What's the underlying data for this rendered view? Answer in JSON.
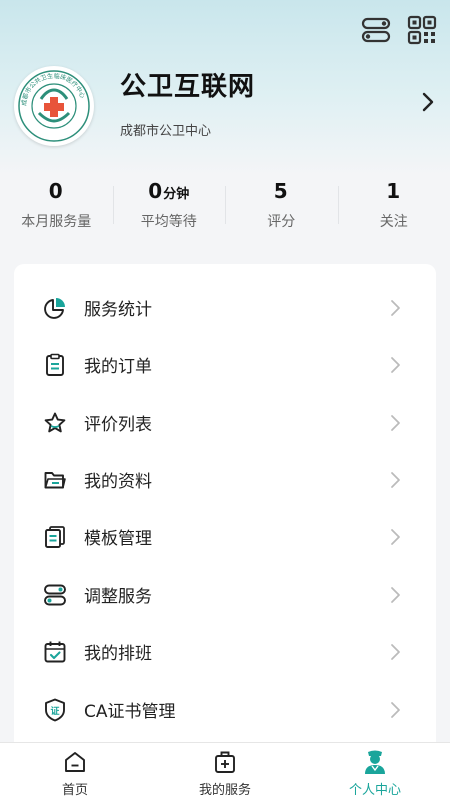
{
  "header": {
    "toggle_icon": "toggle-icon",
    "qr_icon": "qr-code-icon"
  },
  "profile": {
    "name": "公卫互联网",
    "subtitle": "成都市公卫中心",
    "logo_ring_text": "成都市公共卫生临床医疗中心",
    "arrow_icon": "chevron-right-icon"
  },
  "stats": [
    {
      "value": "0",
      "unit": "",
      "label": "本月服务量"
    },
    {
      "value": "0",
      "unit": "分钟",
      "label": "平均等待"
    },
    {
      "value": "5",
      "unit": "",
      "label": "评分"
    },
    {
      "value": "1",
      "unit": "",
      "label": "关注"
    }
  ],
  "menu": [
    {
      "label": "服务统计",
      "icon": "pie-chart-icon"
    },
    {
      "label": "我的订单",
      "icon": "clipboard-icon"
    },
    {
      "label": "评价列表",
      "icon": "star-icon"
    },
    {
      "label": "我的资料",
      "icon": "folder-icon"
    },
    {
      "label": "模板管理",
      "icon": "template-icon"
    },
    {
      "label": "调整服务",
      "icon": "toggle-icon"
    },
    {
      "label": "我的排班",
      "icon": "calendar-check-icon"
    },
    {
      "label": "CA证书管理",
      "icon": "shield-cert-icon"
    }
  ],
  "tabbar": [
    {
      "label": "首页",
      "icon": "home-icon",
      "active": false
    },
    {
      "label": "我的服务",
      "icon": "medical-kit-icon",
      "active": false
    },
    {
      "label": "个人中心",
      "icon": "doctor-icon",
      "active": true
    }
  ],
  "colors": {
    "accent": "#1aa59b",
    "header_gradient_top": "#c9e6ec",
    "logo_green": "#2d8f7a",
    "logo_red": "#e8543a"
  }
}
